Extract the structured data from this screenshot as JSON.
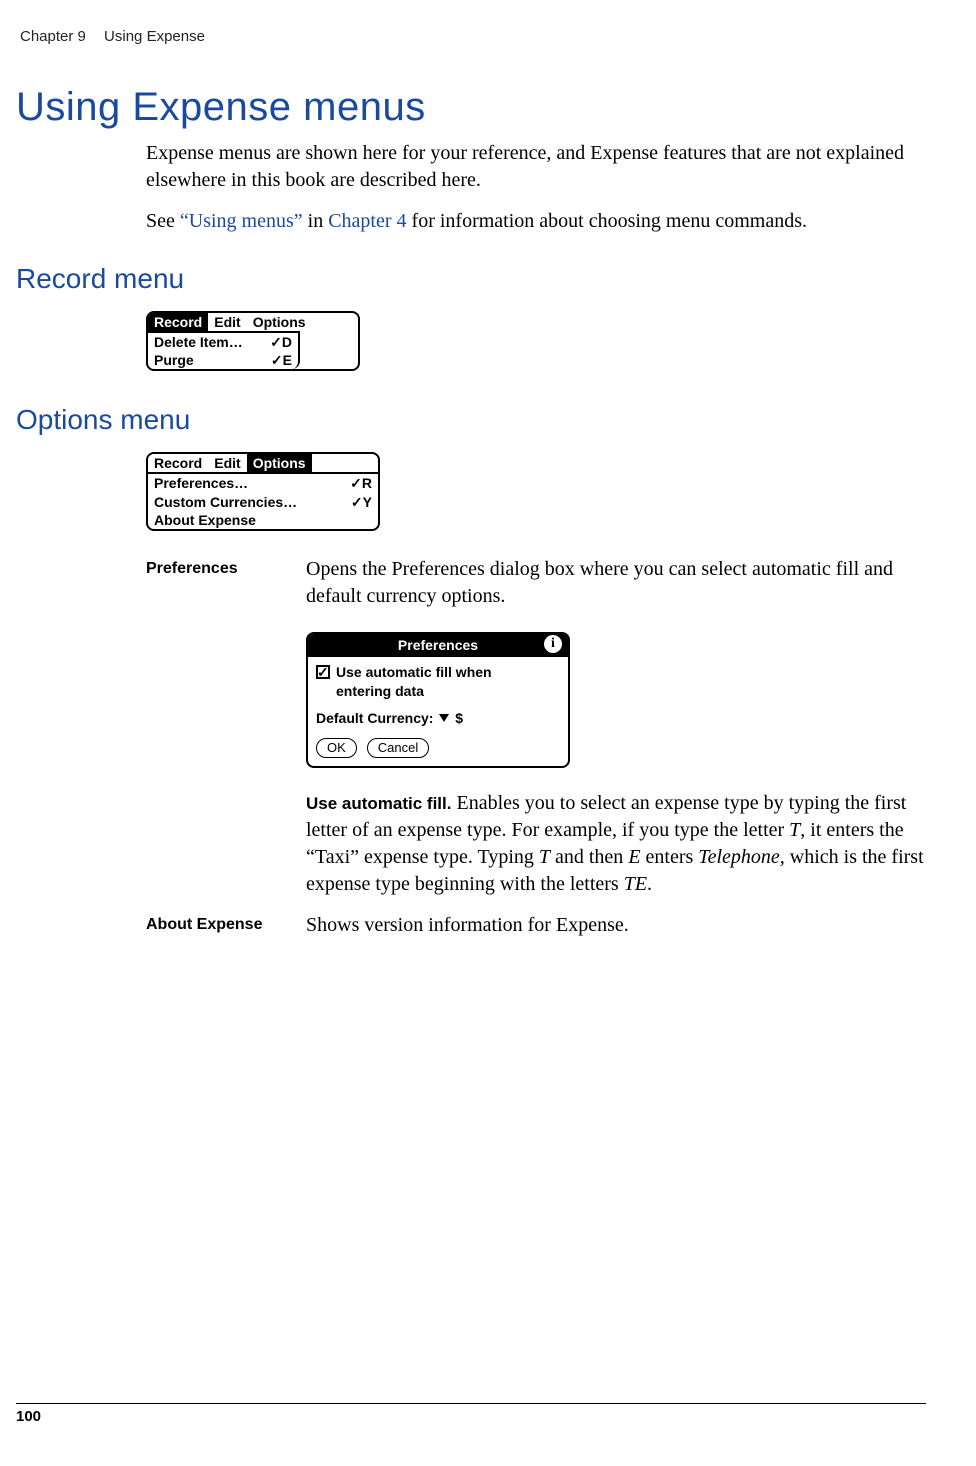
{
  "header": {
    "chapter": "Chapter 9",
    "title": "Using Expense"
  },
  "h1": "Using Expense menus",
  "intro1": "Expense menus are shown here for your reference, and Expense features that are not explained elsewhere in this book are described here.",
  "intro2a": "See ",
  "intro2link1": "“Using menus”",
  "intro2b": " in ",
  "intro2link2": "Chapter 4",
  "intro2c": " for information about choosing menu commands.",
  "h2_record": "Record menu",
  "record_menu": {
    "tabs": [
      "Record",
      "Edit",
      "Options"
    ],
    "items": [
      {
        "label": "Delete Item…",
        "shortcut": "✓D"
      },
      {
        "label": "Purge",
        "shortcut": "✓E"
      }
    ]
  },
  "h2_options": "Options menu",
  "options_menu": {
    "tabs": [
      "Record",
      "Edit",
      "Options"
    ],
    "items": [
      {
        "label": "Preferences…",
        "shortcut": "✓R"
      },
      {
        "label": "Custom Currencies…",
        "shortcut": "✓Y"
      },
      {
        "label": "About Expense",
        "shortcut": ""
      }
    ]
  },
  "table": {
    "rows": [
      {
        "label": "Preferences",
        "p1": "Opens the Preferences dialog box where you can select automatic fill and default currency options.",
        "fill_bold": "Use automatic fill.",
        "fill_a": " Enables you to select an expense type by typing the first letter of an expense type. For example, if you type the letter ",
        "fill_T1": "T",
        "fill_b": ", it enters the “Taxi” expense type. Typing ",
        "fill_T2": "T",
        "fill_c": " and then ",
        "fill_E": "E",
        "fill_d": " enters ",
        "fill_tel": "Telephone,",
        "fill_e": " which is the first expense type beginning with the letters ",
        "fill_TE": "TE",
        "fill_f": "."
      },
      {
        "label": "About Expense",
        "p1": "Shows version information for Expense."
      }
    ]
  },
  "dialog": {
    "title": "Preferences",
    "check_line1": "Use automatic fill when",
    "check_line2": "entering data",
    "currency_label": "Default Currency:",
    "currency_value": "$",
    "ok": "OK",
    "cancel": "Cancel"
  },
  "page_number": "100"
}
